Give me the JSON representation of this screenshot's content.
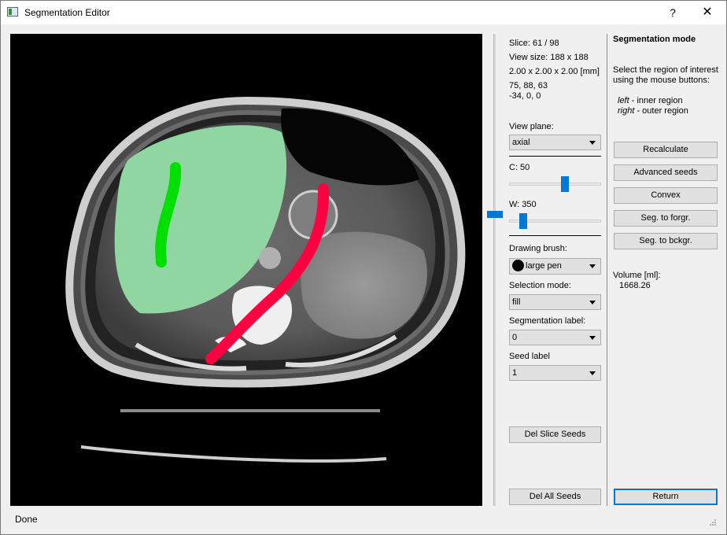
{
  "window": {
    "title": "Segmentation Editor",
    "help_label": "?",
    "close_label": "✕"
  },
  "info": {
    "slice": "Slice: 61 / 98",
    "view_size": "View size: 188 x 188",
    "voxel": "2.00 x 2.00 x 2.00 [mm]",
    "coords1": "75, 88, 63",
    "coords2": "-34, 0, 0"
  },
  "view_plane": {
    "label": "View plane:",
    "value": "axial"
  },
  "contrast": {
    "label": "C: 50",
    "level": 0.62
  },
  "window_width": {
    "label": "W: 350",
    "level": 0.12
  },
  "slice_slider": {
    "level": 0.62
  },
  "drawing_brush": {
    "label": "Drawing brush:",
    "value": "large pen"
  },
  "selection_mode": {
    "label": "Selection mode:",
    "value": "fill"
  },
  "segmentation_label": {
    "label": "Segmentation label:",
    "value": "0"
  },
  "seed_label": {
    "label": "Seed label",
    "value": "1"
  },
  "buttons": {
    "del_slice_seeds": "Del Slice Seeds",
    "del_all_seeds": "Del All Seeds",
    "recalculate": "Recalculate",
    "advanced_seeds": "Advanced seeds",
    "convex": "Convex",
    "seg_to_forgr": "Seg. to forgr.",
    "seg_to_bckgr": "Seg. to bckgr.",
    "return": "Return"
  },
  "mode_panel": {
    "title": "Segmentation mode",
    "instructions_line1": "Select the region of interest",
    "instructions_line2": "using the mouse buttons:",
    "left_key": "left",
    "left_desc": " - inner region",
    "right_key": "right",
    "right_desc": " - outer region"
  },
  "volume": {
    "label": "Volume [ml]:",
    "value": "1668.26"
  },
  "status": "Done",
  "colors": {
    "accent": "#0078d7",
    "inner_seed": "#00e000",
    "outer_seed": "#ff0040",
    "segmentation": "#6fcf8a"
  }
}
